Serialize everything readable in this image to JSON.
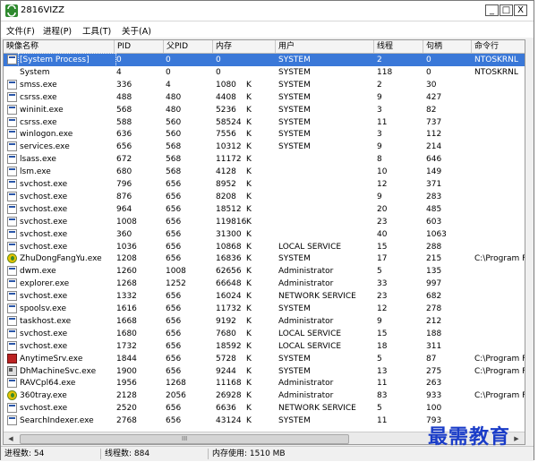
{
  "window": {
    "title": "2816VIZZ",
    "minimize": "_",
    "maximize": "□",
    "close": "X"
  },
  "menu": [
    "文件(F)",
    "进程(P)",
    "工具(T)",
    "关于(A)"
  ],
  "columns": [
    "映像名称",
    "PID",
    "父PID",
    "内存",
    "用户",
    "线程",
    "句柄",
    "命令行"
  ],
  "rows": [
    {
      "icon": "doc",
      "name": "[System Process]",
      "pid": "0",
      "ppid": "0",
      "mem": "0",
      "unit": "",
      "user": "SYSTEM",
      "threads": "2",
      "handles": "0",
      "cmd": "NTOSKRNL",
      "selected": true
    },
    {
      "icon": "none",
      "name": "System",
      "pid": "4",
      "ppid": "0",
      "mem": "0",
      "unit": "",
      "user": "SYSTEM",
      "threads": "118",
      "handles": "0",
      "cmd": "NTOSKRNL"
    },
    {
      "icon": "doc",
      "name": "smss.exe",
      "pid": "336",
      "ppid": "4",
      "mem": "1080",
      "unit": "K",
      "user": "SYSTEM",
      "threads": "2",
      "handles": "30",
      "cmd": ""
    },
    {
      "icon": "doc",
      "name": "csrss.exe",
      "pid": "488",
      "ppid": "480",
      "mem": "4408",
      "unit": "K",
      "user": "SYSTEM",
      "threads": "9",
      "handles": "427",
      "cmd": ""
    },
    {
      "icon": "doc",
      "name": "wininit.exe",
      "pid": "568",
      "ppid": "480",
      "mem": "5236",
      "unit": "K",
      "user": "SYSTEM",
      "threads": "3",
      "handles": "82",
      "cmd": ""
    },
    {
      "icon": "doc",
      "name": "csrss.exe",
      "pid": "588",
      "ppid": "560",
      "mem": "58524",
      "unit": "K",
      "user": "SYSTEM",
      "threads": "11",
      "handles": "737",
      "cmd": ""
    },
    {
      "icon": "doc",
      "name": "winlogon.exe",
      "pid": "636",
      "ppid": "560",
      "mem": "7556",
      "unit": "K",
      "user": "SYSTEM",
      "threads": "3",
      "handles": "112",
      "cmd": ""
    },
    {
      "icon": "doc",
      "name": "services.exe",
      "pid": "656",
      "ppid": "568",
      "mem": "10312",
      "unit": "K",
      "user": "SYSTEM",
      "threads": "9",
      "handles": "214",
      "cmd": ""
    },
    {
      "icon": "doc",
      "name": "lsass.exe",
      "pid": "672",
      "ppid": "568",
      "mem": "11172",
      "unit": "K",
      "user": "",
      "threads": "8",
      "handles": "646",
      "cmd": ""
    },
    {
      "icon": "doc",
      "name": "lsm.exe",
      "pid": "680",
      "ppid": "568",
      "mem": "4128",
      "unit": "K",
      "user": "",
      "threads": "10",
      "handles": "149",
      "cmd": ""
    },
    {
      "icon": "doc",
      "name": "svchost.exe",
      "pid": "796",
      "ppid": "656",
      "mem": "8952",
      "unit": "K",
      "user": "",
      "threads": "12",
      "handles": "371",
      "cmd": ""
    },
    {
      "icon": "doc",
      "name": "svchost.exe",
      "pid": "876",
      "ppid": "656",
      "mem": "8208",
      "unit": "K",
      "user": "",
      "threads": "9",
      "handles": "283",
      "cmd": ""
    },
    {
      "icon": "doc",
      "name": "svchost.exe",
      "pid": "964",
      "ppid": "656",
      "mem": "18512",
      "unit": "K",
      "user": "",
      "threads": "20",
      "handles": "485",
      "cmd": ""
    },
    {
      "icon": "doc",
      "name": "svchost.exe",
      "pid": "1008",
      "ppid": "656",
      "mem": "119816",
      "unit": "K",
      "user": "",
      "threads": "23",
      "handles": "603",
      "cmd": ""
    },
    {
      "icon": "doc",
      "name": "svchost.exe",
      "pid": "360",
      "ppid": "656",
      "mem": "31300",
      "unit": "K",
      "user": "",
      "threads": "40",
      "handles": "1063",
      "cmd": ""
    },
    {
      "icon": "doc",
      "name": "svchost.exe",
      "pid": "1036",
      "ppid": "656",
      "mem": "10868",
      "unit": "K",
      "user": "LOCAL SERVICE",
      "threads": "15",
      "handles": "288",
      "cmd": ""
    },
    {
      "icon": "circle-y",
      "name": "ZhuDongFangYu.exe",
      "pid": "1208",
      "ppid": "656",
      "mem": "16836",
      "unit": "K",
      "user": "SYSTEM",
      "threads": "17",
      "handles": "215",
      "cmd": "C:\\Program Fi"
    },
    {
      "icon": "doc",
      "name": "dwm.exe",
      "pid": "1260",
      "ppid": "1008",
      "mem": "62656",
      "unit": "K",
      "user": "Administrator",
      "threads": "5",
      "handles": "135",
      "cmd": ""
    },
    {
      "icon": "doc",
      "name": "explorer.exe",
      "pid": "1268",
      "ppid": "1252",
      "mem": "66648",
      "unit": "K",
      "user": "Administrator",
      "threads": "33",
      "handles": "997",
      "cmd": ""
    },
    {
      "icon": "doc",
      "name": "svchost.exe",
      "pid": "1332",
      "ppid": "656",
      "mem": "16024",
      "unit": "K",
      "user": "NETWORK SERVICE",
      "threads": "23",
      "handles": "682",
      "cmd": ""
    },
    {
      "icon": "doc",
      "name": "spoolsv.exe",
      "pid": "1616",
      "ppid": "656",
      "mem": "11732",
      "unit": "K",
      "user": "SYSTEM",
      "threads": "12",
      "handles": "278",
      "cmd": ""
    },
    {
      "icon": "doc",
      "name": "taskhost.exe",
      "pid": "1668",
      "ppid": "656",
      "mem": "9192",
      "unit": "K",
      "user": "Administrator",
      "threads": "9",
      "handles": "212",
      "cmd": ""
    },
    {
      "icon": "doc",
      "name": "svchost.exe",
      "pid": "1680",
      "ppid": "656",
      "mem": "7680",
      "unit": "K",
      "user": "LOCAL SERVICE",
      "threads": "15",
      "handles": "188",
      "cmd": ""
    },
    {
      "icon": "doc",
      "name": "svchost.exe",
      "pid": "1732",
      "ppid": "656",
      "mem": "18592",
      "unit": "K",
      "user": "LOCAL SERVICE",
      "threads": "18",
      "handles": "311",
      "cmd": ""
    },
    {
      "icon": "red",
      "name": "AnytimeSrv.exe",
      "pid": "1844",
      "ppid": "656",
      "mem": "5728",
      "unit": "K",
      "user": "SYSTEM",
      "threads": "5",
      "handles": "87",
      "cmd": "C:\\Program Fi"
    },
    {
      "icon": "grid",
      "name": "DhMachineSvc.exe",
      "pid": "1900",
      "ppid": "656",
      "mem": "9244",
      "unit": "K",
      "user": "SYSTEM",
      "threads": "13",
      "handles": "275",
      "cmd": "C:\\Program Fi"
    },
    {
      "icon": "doc",
      "name": "RAVCpl64.exe",
      "pid": "1956",
      "ppid": "1268",
      "mem": "11168",
      "unit": "K",
      "user": "Administrator",
      "threads": "11",
      "handles": "263",
      "cmd": ""
    },
    {
      "icon": "circle-y",
      "name": "360tray.exe",
      "pid": "2128",
      "ppid": "2056",
      "mem": "26928",
      "unit": "K",
      "user": "Administrator",
      "threads": "83",
      "handles": "933",
      "cmd": "C:\\Program Fi"
    },
    {
      "icon": "doc",
      "name": "svchost.exe",
      "pid": "2520",
      "ppid": "656",
      "mem": "6636",
      "unit": "K",
      "user": "NETWORK SERVICE",
      "threads": "5",
      "handles": "100",
      "cmd": ""
    },
    {
      "icon": "doc",
      "name": "SearchIndexer.exe",
      "pid": "2768",
      "ppid": "656",
      "mem": "43124",
      "unit": "K",
      "user": "SYSTEM",
      "threads": "11",
      "handles": "793",
      "cmd": ""
    }
  ],
  "scrollbar": {
    "left_arrow": "◀",
    "right_arrow": "▶",
    "grip": "III"
  },
  "status": {
    "processes": "进程数: 54",
    "threads": "线程数: 884",
    "memory": "内存使用: 1510 MB"
  },
  "watermark": "最需教育"
}
